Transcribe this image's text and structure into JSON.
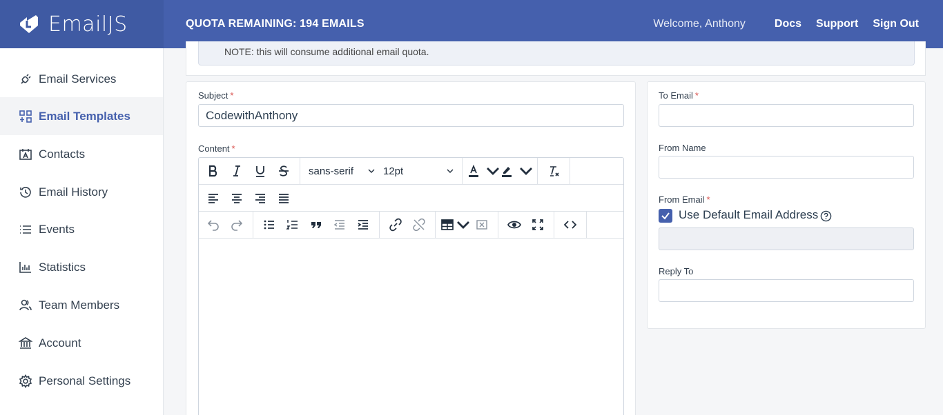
{
  "app": {
    "name": "EmailJS"
  },
  "header": {
    "quota": "QUOTA REMAINING: 194 EMAILS",
    "welcome_label": "Welcome,",
    "user_name": "Anthony",
    "links": {
      "docs": "Docs",
      "support": "Support",
      "sign_out": "Sign Out"
    }
  },
  "sidebar": {
    "items": [
      {
        "label": "Email Services",
        "icon": "plug-icon"
      },
      {
        "label": "Email Templates",
        "icon": "templates-icon",
        "active": true
      },
      {
        "label": "Contacts",
        "icon": "contacts-icon"
      },
      {
        "label": "Email History",
        "icon": "history-icon"
      },
      {
        "label": "Events",
        "icon": "list-icon"
      },
      {
        "label": "Statistics",
        "icon": "chart-icon"
      },
      {
        "label": "Team Members",
        "icon": "team-icon"
      },
      {
        "label": "Account",
        "icon": "bank-icon"
      },
      {
        "label": "Personal Settings",
        "icon": "gear-icon"
      }
    ]
  },
  "note": {
    "text": "NOTE: this will consume additional email quota."
  },
  "form": {
    "subject": {
      "label": "Subject",
      "value": "CodewithAnthony"
    },
    "content": {
      "label": "Content"
    },
    "editor": {
      "font_family": "sans-serif",
      "font_size": "12pt"
    },
    "to_email": {
      "label": "To Email",
      "value": ""
    },
    "from_name": {
      "label": "From Name",
      "value": ""
    },
    "from_email": {
      "label": "From Email",
      "default_label": "Use Default Email Address",
      "use_default": true,
      "value": ""
    },
    "reply_to": {
      "label": "Reply To",
      "value": ""
    },
    "required_mark": "*"
  },
  "colors": {
    "brand": "#4560ad",
    "brand_dark": "#3f5aa3",
    "required": "#d9534f"
  }
}
